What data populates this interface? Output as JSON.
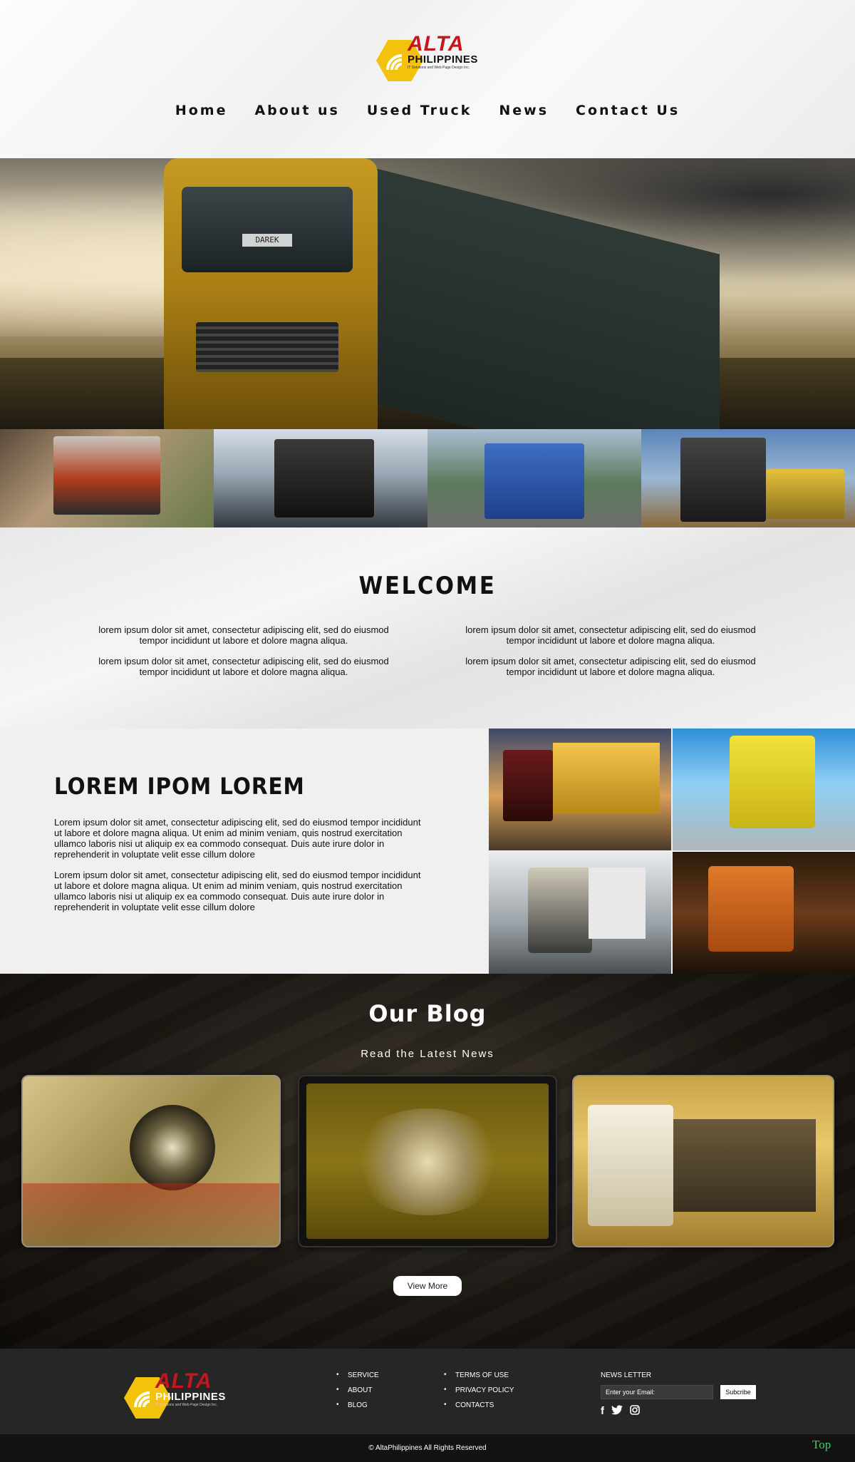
{
  "brand": {
    "name": "ALTA",
    "sub": "PHILIPPINES",
    "tagline": "IT Solutions and Web Page Design Inc."
  },
  "nav": [
    "Home",
    "About us",
    "Used Truck",
    "News",
    "Contact Us"
  ],
  "hero": {
    "plate": "DAREK"
  },
  "welcome": {
    "title": "WELCOME",
    "left": [
      "lorem ipsum dolor sit amet, consectetur adipiscing elit, sed do eiusmod tempor incididunt ut labore et dolore magna aliqua.",
      "lorem ipsum dolor sit amet, consectetur adipiscing elit, sed do eiusmod tempor incididunt ut labore et dolore magna aliqua."
    ],
    "right": [
      "lorem ipsum dolor sit amet, consectetur adipiscing elit, sed do eiusmod tempor incididunt ut labore et dolore magna aliqua.",
      "lorem ipsum dolor sit amet, consectetur adipiscing elit, sed do eiusmod tempor incididunt ut labore et dolore magna aliqua."
    ]
  },
  "lorem": {
    "title": "LOREM IPOM LOREM",
    "paragraphs": [
      "Lorem ipsum dolor sit amet, consectetur adipiscing elit, sed do eiusmod tempor incididunt ut labore et dolore magna aliqua. Ut enim ad minim veniam, quis nostrud exercitation ullamco laboris nisi ut aliquip ex ea commodo consequat. Duis aute irure dolor in reprehenderit in voluptate velit esse cillum dolore",
      "Lorem ipsum dolor sit amet, consectetur adipiscing elit, sed do eiusmod tempor incididunt ut labore et dolore magna aliqua. Ut enim ad minim veniam, quis nostrud exercitation ullamco laboris nisi ut aliquip ex ea commodo consequat. Duis aute irure dolor in reprehenderit in voluptate velit esse cillum dolore"
    ]
  },
  "blog": {
    "title": "Our Blog",
    "subtitle": "Read the Latest News",
    "view_more": "View More"
  },
  "footer": {
    "links_a": [
      "SERVICE",
      "ABOUT",
      "BLOG"
    ],
    "links_b": [
      "TERMS OF USE",
      "PRIVACY POLICY",
      "CONTACTS"
    ],
    "newsletter_label": "NEWS LETTER",
    "email_placeholder": "Enter your Email:",
    "subscribe": "Subcribe",
    "social": [
      "facebook-icon",
      "twitter-icon",
      "instagram-icon"
    ]
  },
  "copyright": "© AltaPhilippines All Rights Reserved",
  "top": "Top",
  "colors": {
    "brand_yellow": "#f4c20d",
    "brand_red": "#c4161c",
    "top_green": "#3bd26b"
  }
}
